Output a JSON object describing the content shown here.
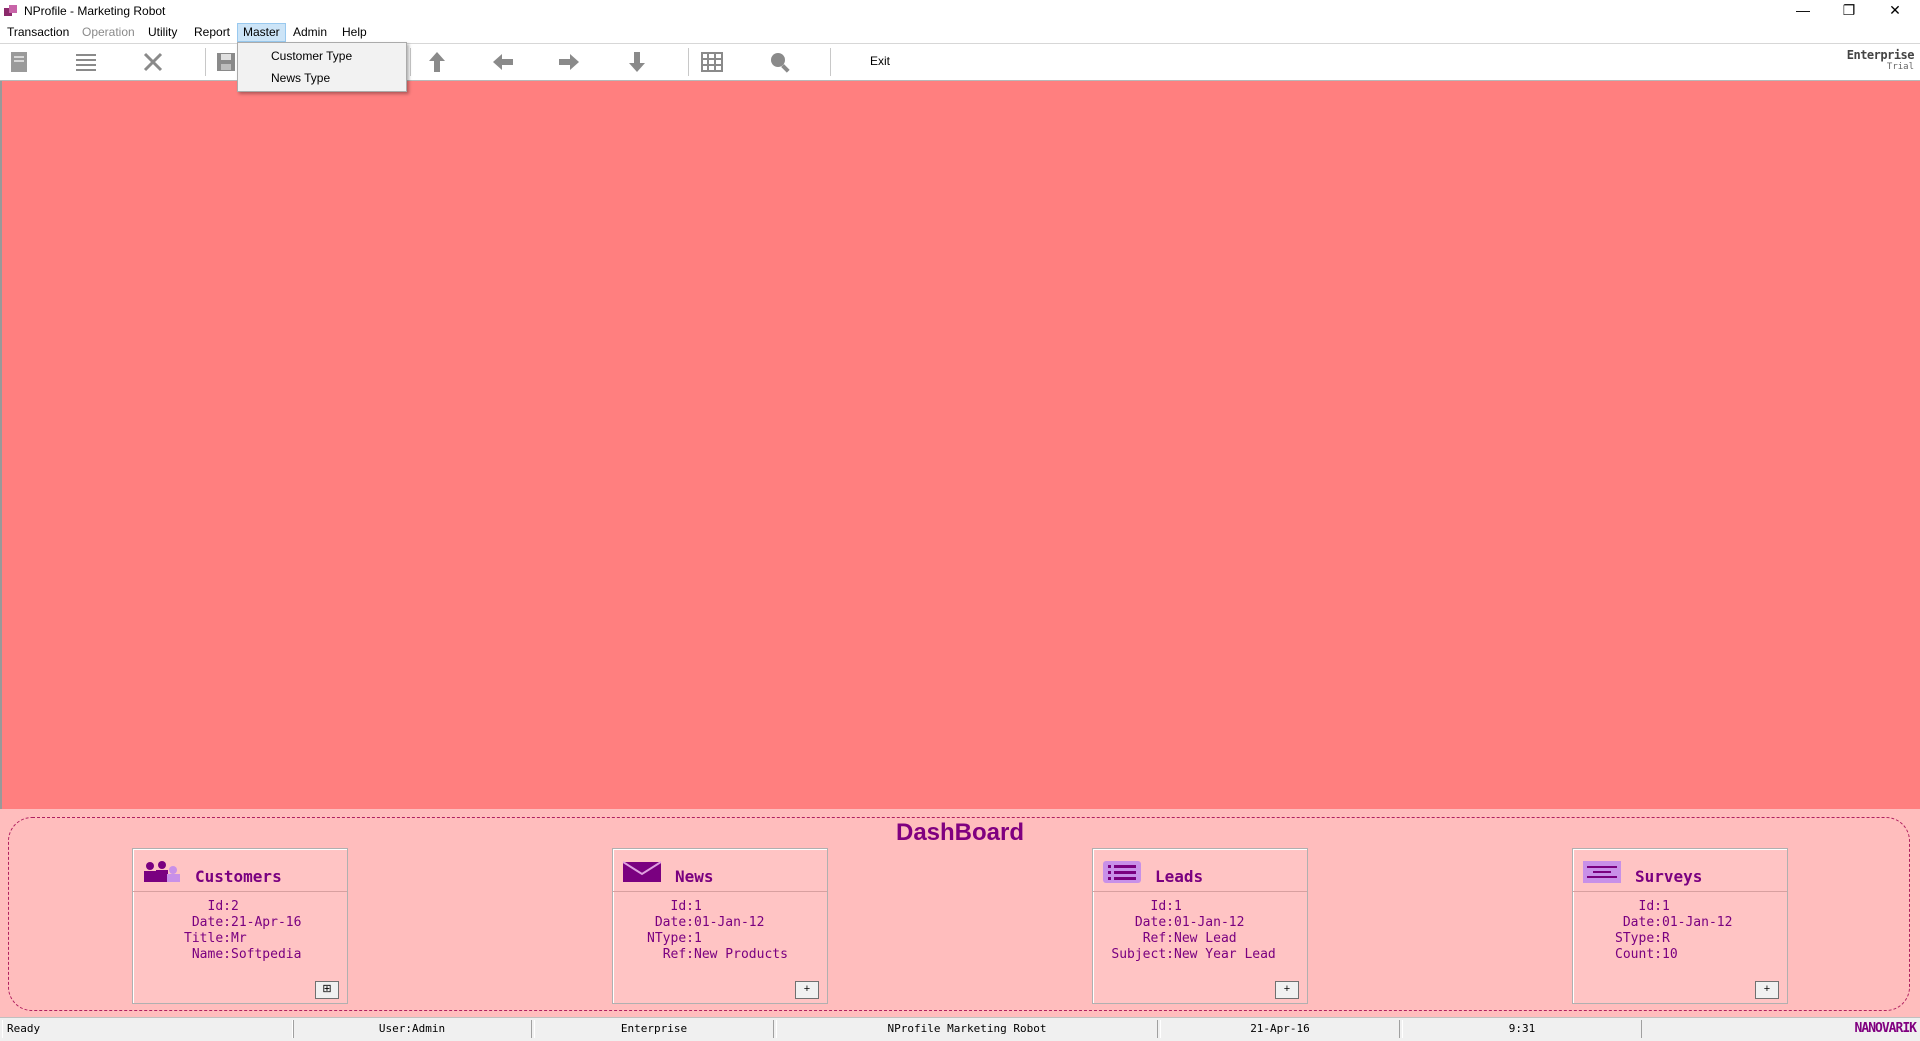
{
  "window": {
    "title": "NProfile - Marketing Robot",
    "minimize_glyph": "—",
    "maximize_glyph": "❐",
    "close_glyph": "✕"
  },
  "menu": {
    "items": [
      {
        "label": "Transaction",
        "disabled": false
      },
      {
        "label": "Operation",
        "disabled": true
      },
      {
        "label": "Utility",
        "disabled": false
      },
      {
        "label": "Report",
        "disabled": false
      },
      {
        "label": "Master",
        "disabled": false,
        "active": true
      },
      {
        "label": "Admin",
        "disabled": false
      },
      {
        "label": "Help",
        "disabled": false
      }
    ],
    "master_dropdown": [
      "Customer Type",
      "News Type"
    ]
  },
  "toolbar": {
    "icons": [
      "new-document-icon",
      "list-icon",
      "delete-icon",
      "save-icon",
      "first-record-icon",
      "previous-record-icon",
      "next-record-icon",
      "last-record-icon",
      "grid-icon",
      "search-icon"
    ],
    "exit_label": "Exit",
    "edition_label": "Enterprise",
    "edition_sub": "Trial"
  },
  "colors": {
    "main_bg": "#ff7f7f",
    "dashboard_bg": "#ffbdbd",
    "accent": "#800080"
  },
  "dashboard": {
    "title": "DashBoard",
    "cards": [
      {
        "title": "Customers",
        "icon": "customers-icon",
        "fields": [
          {
            "label": "Id:",
            "value": "2"
          },
          {
            "label": "Date:",
            "value": "21-Apr-16"
          },
          {
            "label": "Title:",
            "value": "Mr"
          },
          {
            "label": "Name:",
            "value": "Softpedia"
          }
        ],
        "button": "⊞"
      },
      {
        "title": "News",
        "icon": "news-icon",
        "fields": [
          {
            "label": "Id:",
            "value": "1"
          },
          {
            "label": "Date:",
            "value": "01-Jan-12"
          },
          {
            "label": "NType:",
            "value": "1"
          },
          {
            "label": "Ref:",
            "value": "New Products"
          }
        ],
        "button": "+"
      },
      {
        "title": "Leads",
        "icon": "leads-icon",
        "fields": [
          {
            "label": "Id:",
            "value": "1"
          },
          {
            "label": "Date:",
            "value": "01-Jan-12"
          },
          {
            "label": "Ref:",
            "value": "New Lead"
          },
          {
            "label": "Subject:",
            "value": "New Year Lead"
          }
        ],
        "button": "+"
      },
      {
        "title": "Surveys",
        "icon": "surveys-icon",
        "fields": [
          {
            "label": "Id:",
            "value": "1"
          },
          {
            "label": "Date:",
            "value": "01-Jan-12"
          },
          {
            "label": "SType:",
            "value": "R"
          },
          {
            "label": "Count:",
            "value": "10"
          }
        ],
        "button": "+"
      }
    ]
  },
  "statusbar": {
    "status": "Ready",
    "user": "User:Admin",
    "edition": "Enterprise",
    "product": "NProfile Marketing Robot",
    "date": "21-Apr-16",
    "time": "9:31",
    "logo": "NANOVARIK"
  }
}
